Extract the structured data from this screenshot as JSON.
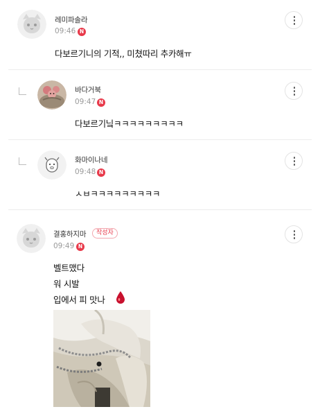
{
  "comments": [
    {
      "author": "레미파솔라",
      "time": "09:46",
      "new_badge": "N",
      "text": "다보르기니의 기적,, 미쳤따리 추카해ㅠ",
      "is_reply": false
    },
    {
      "author": "바다거북",
      "time": "09:47",
      "new_badge": "N",
      "text": "다보르기닠ㅋㅋㅋㅋㅋㅋㅋㅋㅋ",
      "is_reply": true
    },
    {
      "author": "화마이나네",
      "time": "09:48",
      "new_badge": "N",
      "text": "ㅅㅂㅋㅋㅋㅋㅋㅋㅋㅋㅋ",
      "is_reply": true
    },
    {
      "author": "결홍하지마",
      "author_tag": "작성자",
      "time": "09:49",
      "new_badge": "N",
      "lines": [
        "벨트맸다",
        "워 시발",
        "입에서 피 맛나"
      ],
      "emoji": "🩸",
      "is_reply": false
    }
  ],
  "colors": {
    "accent": "#e8394a",
    "divider": "#ececec",
    "muted": "#9a9a9a"
  }
}
